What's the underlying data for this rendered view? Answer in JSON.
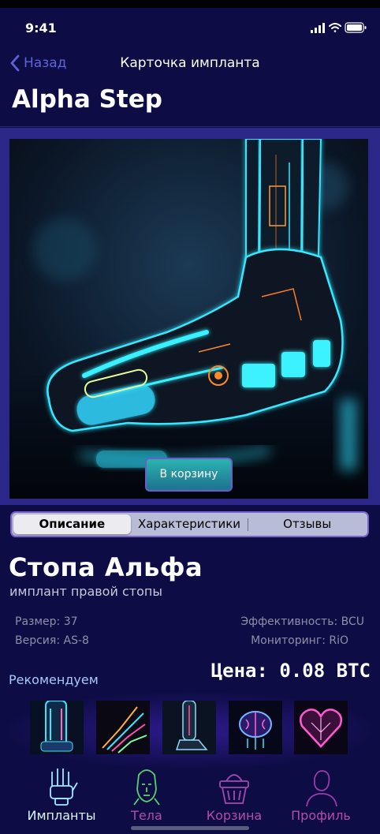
{
  "status": {
    "time": "9:41"
  },
  "nav": {
    "back_label": "Назад",
    "title": "Карточка импланта"
  },
  "header": {
    "large_title": "Alpha Step"
  },
  "hero": {
    "cart_button": "В корзину"
  },
  "tabs": [
    {
      "label": "Описание",
      "active": true
    },
    {
      "label": "Характеристики",
      "active": false
    },
    {
      "label": "Отзывы",
      "active": false
    }
  ],
  "product": {
    "name": "Стопа Альфа",
    "subtitle": "имплант правой стопы",
    "specs": {
      "size": "Размер: 37",
      "version": "Версия: AS-8",
      "efficiency": "Эффективность: BCU",
      "monitoring": "Мониторинг: RiO"
    },
    "price": "Цена: 0.08 BTC"
  },
  "recommend": {
    "label": "Рекомендуем"
  },
  "tabbar": [
    {
      "label": "Импланты",
      "icon": "robot-hand-icon",
      "color": "#d9f4ff"
    },
    {
      "label": "Тела",
      "icon": "cyber-head-icon",
      "color": "#b04ea6"
    },
    {
      "label": "Корзина",
      "icon": "basket-icon",
      "color": "#b04ea6"
    },
    {
      "label": "Профиль",
      "icon": "profile-icon",
      "color": "#b04ea6"
    }
  ],
  "colors": {
    "background": "#0e0c45",
    "accent": "#5f63d8",
    "hero_bg": "#2b2789",
    "neon": "#33e6ff"
  }
}
